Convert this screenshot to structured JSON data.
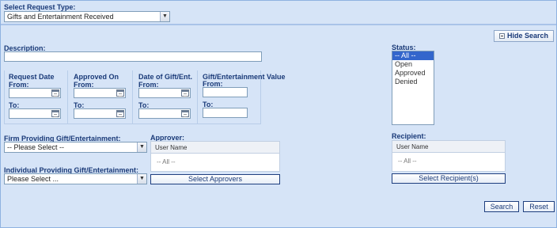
{
  "request_type": {
    "label": "Select Request Type:",
    "value": "Gifts and Entertainment Received"
  },
  "hide_search": {
    "label": "Hide Search"
  },
  "description": {
    "label": "Description:",
    "value": ""
  },
  "request_date": {
    "title": "Request Date",
    "from": "From:",
    "to": "To:"
  },
  "approved_on": {
    "title": "Approved On",
    "from": "From:",
    "to": "To:"
  },
  "gift_date": {
    "title": "Date of Gift/Ent.",
    "from": "From:",
    "to": "To:"
  },
  "gift_value": {
    "title": "Gift/Entertainment Value",
    "from": "From:",
    "to": "To:"
  },
  "status": {
    "label": "Status:",
    "options": [
      "-- All --",
      "Open",
      "Approved",
      "Denied"
    ],
    "selected": "-- All --"
  },
  "firm": {
    "label": "Firm Providing Gift/Entertainment:",
    "value": "-- Please Select --"
  },
  "individual": {
    "label": "Individual Providing Gift/Entertainment:",
    "value": "Please Select ..."
  },
  "approver": {
    "label": "Approver:",
    "column": "User Name",
    "value": "-- All --",
    "button": "Select Approvers"
  },
  "recipient": {
    "label": "Recipient:",
    "column": "User Name",
    "value": "-- All --",
    "button": "Select Recipient(s)"
  },
  "actions": {
    "search": "Search",
    "reset": "Reset"
  },
  "icons": {
    "dropdown": "chevron-down-icon",
    "calendar": "calendar-icon",
    "collapse": "collapse-icon"
  },
  "colors": {
    "panel": "#d6e4f7",
    "selected_option": "#3366cc",
    "label_text": "#1a3a78"
  }
}
